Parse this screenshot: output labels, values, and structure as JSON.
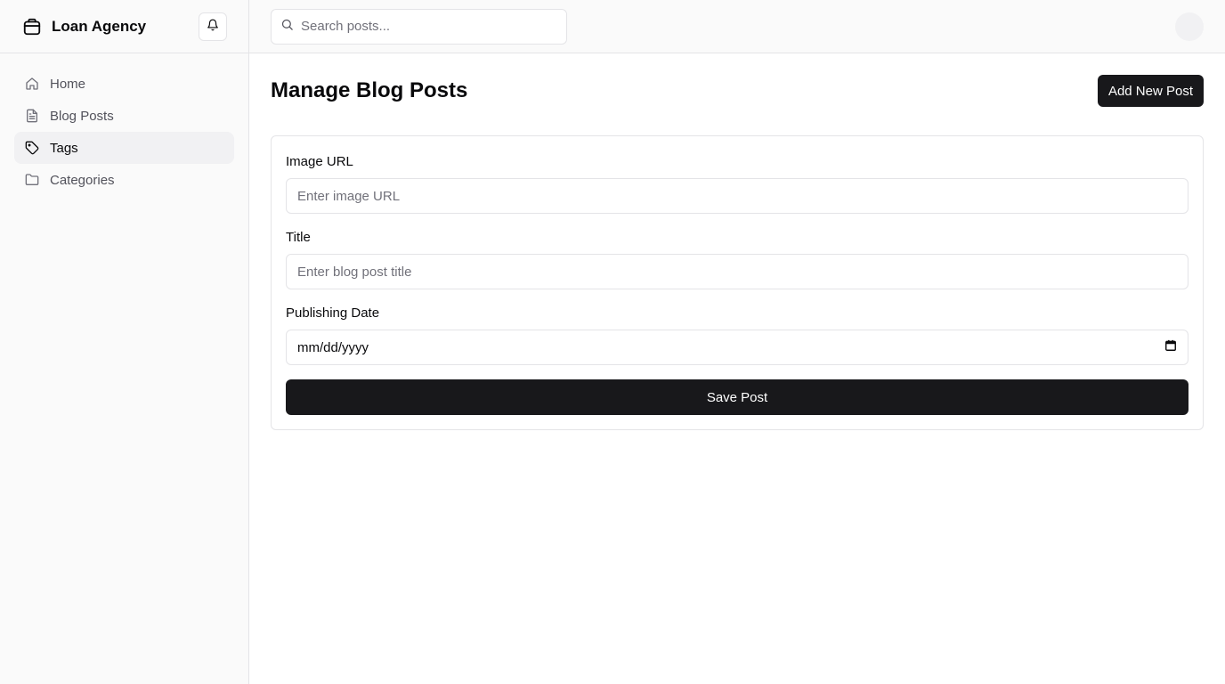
{
  "brand": {
    "name": "Loan Agency",
    "logo_icon": "box-icon"
  },
  "header": {
    "notifications_icon": "bell-icon"
  },
  "sidebar": {
    "items": [
      {
        "label": "Home",
        "icon": "home-icon",
        "active": false
      },
      {
        "label": "Blog Posts",
        "icon": "file-text-icon",
        "active": false
      },
      {
        "label": "Tags",
        "icon": "tag-icon",
        "active": true
      },
      {
        "label": "Categories",
        "icon": "folder-icon",
        "active": false
      }
    ]
  },
  "topbar": {
    "search_placeholder": "Search posts...",
    "search_value": ""
  },
  "page": {
    "title": "Manage Blog Posts",
    "add_button_label": "Add New Post"
  },
  "form": {
    "image_url_label": "Image URL",
    "image_url_placeholder": "Enter image URL",
    "image_url_value": "",
    "title_label": "Title",
    "title_placeholder": "Enter blog post title",
    "title_value": "",
    "date_label": "Publishing Date",
    "date_display": "mm/dd/yyyy",
    "save_label": "Save Post"
  },
  "colors": {
    "primary": "#18181b",
    "border": "#e4e4e7",
    "sidebar_bg": "#fafafa",
    "active_bg": "#f1f1f3",
    "muted_text": "#52525b"
  }
}
